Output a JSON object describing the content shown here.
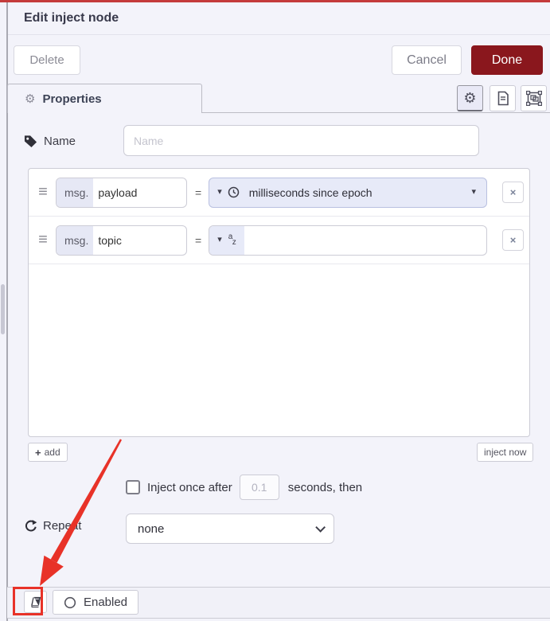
{
  "window": {
    "title": "Edit inject node"
  },
  "toolbar": {
    "delete_label": "Delete",
    "cancel_label": "Cancel",
    "done_label": "Done"
  },
  "tabs": {
    "properties_label": "Properties"
  },
  "name_field": {
    "label": "Name",
    "placeholder": "Name"
  },
  "properties_list": {
    "rows": [
      {
        "prefix": "msg.",
        "property": "payload",
        "equals": "=",
        "type_label": "milliseconds since epoch"
      },
      {
        "prefix": "msg.",
        "property": "topic",
        "equals": "=",
        "type_label": ""
      }
    ],
    "add_label": "add",
    "inject_now_label": "inject now"
  },
  "once": {
    "label_before": "Inject once after",
    "delay_value": "0.1",
    "label_after": "seconds, then",
    "checked": false
  },
  "repeat": {
    "label": "Repeat",
    "selected": "none"
  },
  "footer": {
    "enabled_label": "Enabled"
  },
  "icons": {
    "gear": "⚙",
    "caret_down": "▾",
    "drag_handle": "≡",
    "close": "×",
    "plus": "+",
    "az_top": "a",
    "az_bottom": "z"
  },
  "colors": {
    "accent_red": "#8a171d",
    "annotation_red": "#e83228",
    "top_bar_red": "#c43b3b",
    "typed_input_bg": "#e7eaf8",
    "page_bg": "#f3f3fa"
  }
}
